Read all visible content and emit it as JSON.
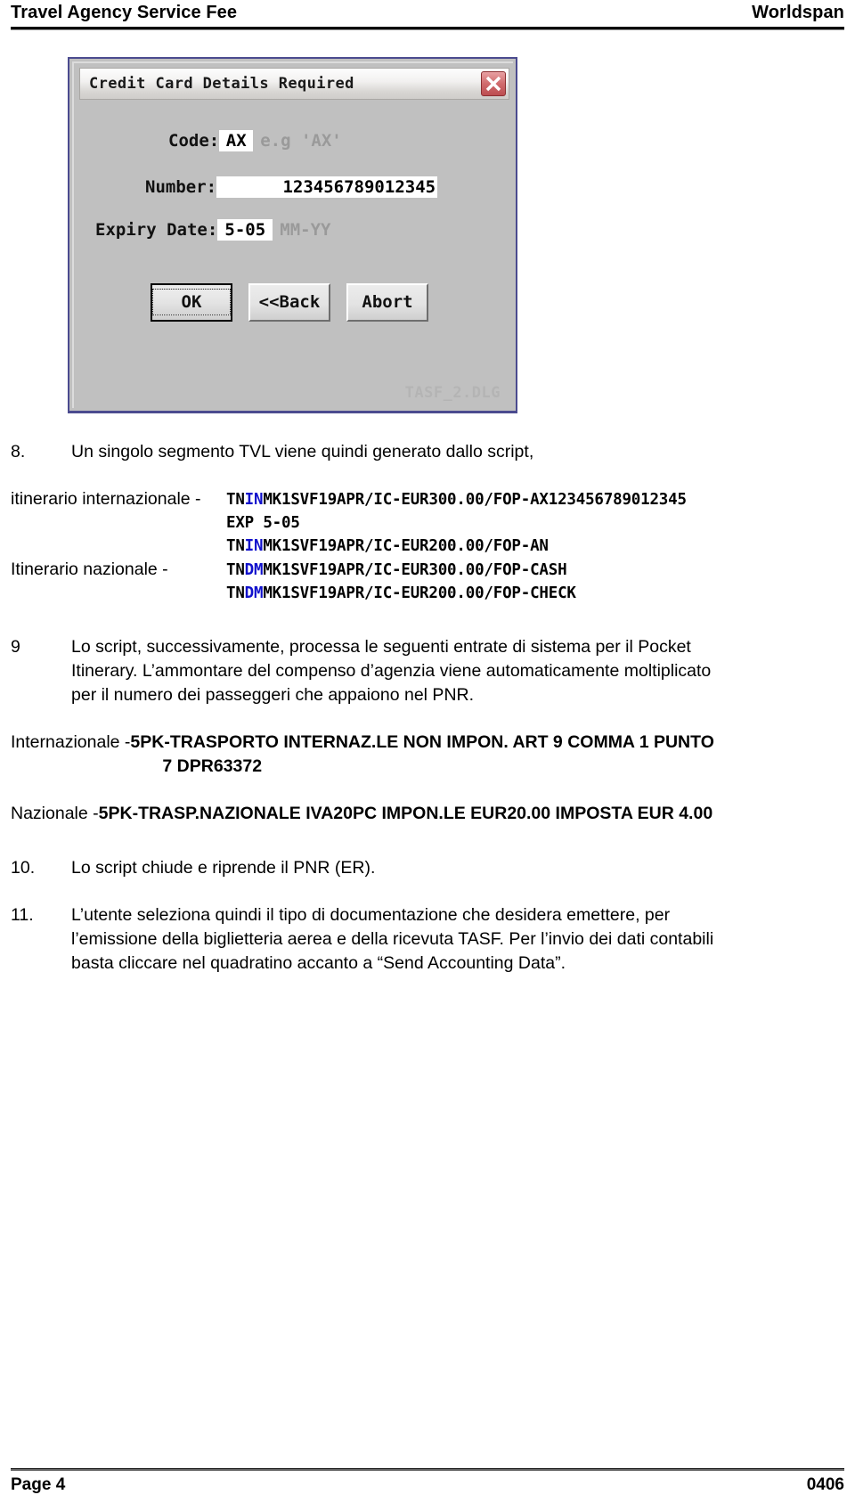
{
  "header": {
    "left_title": "Travel Agency Service Fee",
    "right_title": "Worldspan"
  },
  "dialog": {
    "title": "Credit Card Details Required",
    "close_icon": "close-x-icon",
    "file_label": "TASF_2.DLG",
    "fields": [
      {
        "label": "Code:",
        "value": "AX",
        "hint": "e.g 'AX'"
      },
      {
        "label": "Number:",
        "value": "123456789012345",
        "hint": ""
      },
      {
        "label": "Expiry Date:",
        "value": "5-05",
        "hint": "MM-YY"
      }
    ],
    "buttons": [
      {
        "label": "OK",
        "default": true
      },
      {
        "label": "<<Back",
        "default": false
      },
      {
        "label": "Abort",
        "default": false
      }
    ]
  },
  "content": {
    "item8": {
      "number": "8.",
      "text": "Un singolo segmento TVL viene quindi generato dallo script,",
      "itinerary": [
        {
          "tag": "itinerario internazionale -",
          "code_pre": "TN",
          "code_hl": "IN",
          "code_post": "MK1SVF19APR/IC-EUR300.00/FOP-AX123456789012345"
        },
        {
          "tag": "",
          "code_pre": "EXP 5-05",
          "code_hl": "",
          "code_post": ""
        },
        {
          "tag": "",
          "code_pre": "TN",
          "code_hl": "IN",
          "code_post": "MK1SVF19APR/IC-EUR200.00/FOP-AN"
        },
        {
          "tag": "Itinerario nazionale -",
          "code_pre": "TN",
          "code_hl": "DM",
          "code_post": "MK1SVF19APR/IC-EUR300.00/FOP-CASH"
        },
        {
          "tag": "",
          "code_pre": "TN",
          "code_hl": "DM",
          "code_post": "MK1SVF19APR/IC-EUR200.00/FOP-CHECK"
        }
      ]
    },
    "item9": {
      "number": "9",
      "line1": "Lo script, successivamente, processa le seguenti entrate di sistema per il Pocket",
      "line2": "Itinerary. L’ammontare del compenso d’agenzia viene automaticamente moltiplicato",
      "line3": "per il numero dei passeggeri che appaiono nel PNR."
    },
    "entries": {
      "internazionale_label": "Internazionale - ",
      "internazionale_value_line1": "5PK-TRASPORTO INTERNAZ.LE NON IMPON. ART 9 COMMA 1 PUNTO",
      "internazionale_value_line2": "7 DPR63372",
      "nazionale_label": "Nazionale - ",
      "nazionale_value": "5PK-TRASP.NAZIONALE IVA20PC IMPON.LE EUR20.00 IMPOSTA EUR 4.00"
    },
    "item10": {
      "number": "10.",
      "text": "Lo script chiude e riprende il PNR (ER)."
    },
    "item11": {
      "number": "11.",
      "line1": "L’utente seleziona quindi il tipo di documentazione che desidera emettere, per",
      "line2": "l’emissione della biglietteria aerea e della ricevuta TASF.  Per l’invio dei dati contabili",
      "line3": "basta cliccare nel quadratino accanto a “Send Accounting Data”."
    }
  },
  "footer": {
    "page": "Page 4",
    "code": "0406"
  }
}
